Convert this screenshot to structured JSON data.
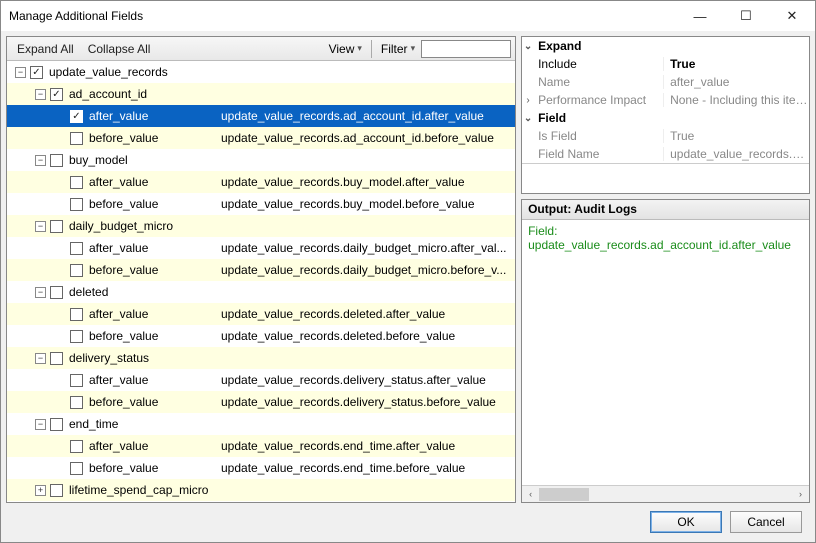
{
  "window": {
    "title": "Manage Additional Fields"
  },
  "toolbar": {
    "expand_all": "Expand All",
    "collapse_all": "Collapse All",
    "view": "View",
    "filter": "Filter",
    "filter_value": ""
  },
  "tree": {
    "root": {
      "label": "update_value_records",
      "checked": true
    },
    "nodes": [
      {
        "key": "ad_account_id",
        "checked": true,
        "children": [
          {
            "key": "after_value",
            "checked": true,
            "selected": true,
            "path": "update_value_records.ad_account_id.after_value"
          },
          {
            "key": "before_value",
            "path": "update_value_records.ad_account_id.before_value"
          }
        ]
      },
      {
        "key": "buy_model",
        "children": [
          {
            "key": "after_value",
            "path": "update_value_records.buy_model.after_value"
          },
          {
            "key": "before_value",
            "path": "update_value_records.buy_model.before_value"
          }
        ]
      },
      {
        "key": "daily_budget_micro",
        "children": [
          {
            "key": "after_value",
            "path": "update_value_records.daily_budget_micro.after_val..."
          },
          {
            "key": "before_value",
            "path": "update_value_records.daily_budget_micro.before_v..."
          }
        ]
      },
      {
        "key": "deleted",
        "children": [
          {
            "key": "after_value",
            "path": "update_value_records.deleted.after_value"
          },
          {
            "key": "before_value",
            "path": "update_value_records.deleted.before_value"
          }
        ]
      },
      {
        "key": "delivery_status",
        "children": [
          {
            "key": "after_value",
            "path": "update_value_records.delivery_status.after_value"
          },
          {
            "key": "before_value",
            "path": "update_value_records.delivery_status.before_value"
          }
        ]
      },
      {
        "key": "end_time",
        "children": [
          {
            "key": "after_value",
            "path": "update_value_records.end_time.after_value"
          },
          {
            "key": "before_value",
            "path": "update_value_records.end_time.before_value"
          }
        ]
      },
      {
        "key": "lifetime_spend_cap_micro",
        "expander": "plus"
      }
    ]
  },
  "props": {
    "expand_hdr": "Expand",
    "include_k": "Include",
    "include_v": "True",
    "name_k": "Name",
    "name_v": "after_value",
    "perf_k": "Performance Impact",
    "perf_v": "None - Including this item will ha",
    "field_hdr": "Field",
    "isfield_k": "Is Field",
    "isfield_v": "True",
    "fieldname_k": "Field Name",
    "fieldname_v": "update_value_records.ad_acco"
  },
  "output": {
    "title": "Output: Audit Logs",
    "field_label": "Field: ",
    "field_value": "update_value_records.ad_account_id.after_value"
  },
  "footer": {
    "ok": "OK",
    "cancel": "Cancel"
  }
}
